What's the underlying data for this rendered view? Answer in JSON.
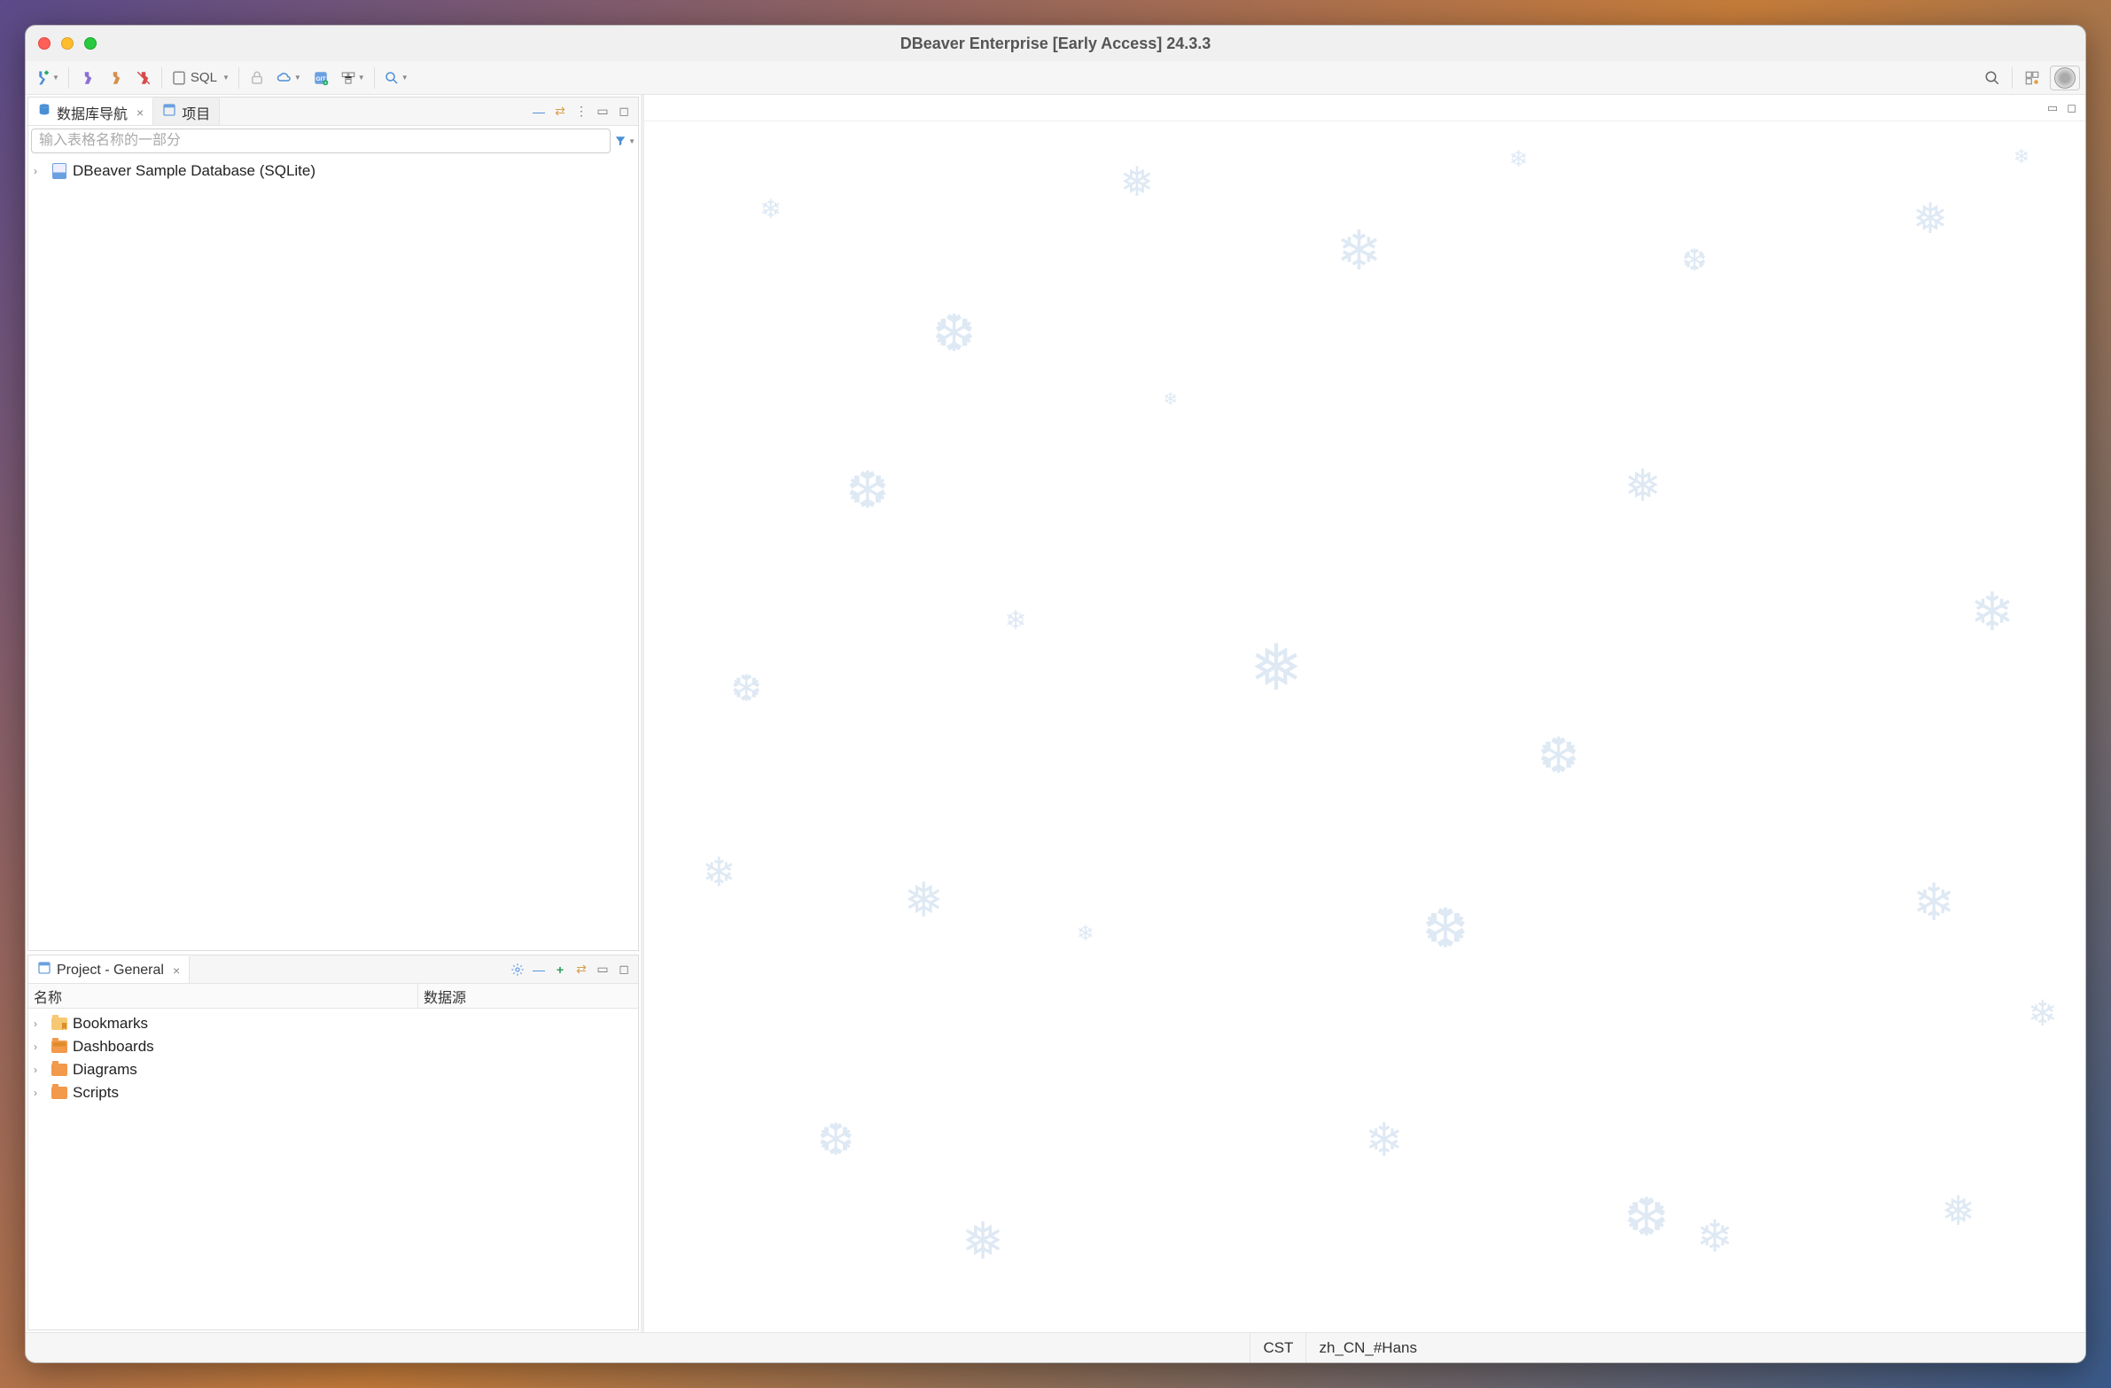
{
  "window": {
    "title": "DBeaver Enterprise [Early Access] 24.3.3"
  },
  "toolbar": {
    "sql_label": "SQL"
  },
  "navigator": {
    "tab_label": "数据库导航",
    "projects_tab_label": "项目",
    "filter_placeholder": "输入表格名称的一部分",
    "items": [
      {
        "label": "DBeaver Sample Database (SQLite)"
      }
    ]
  },
  "project_panel": {
    "tab_label": "Project - General",
    "columns": {
      "name": "名称",
      "datasource": "数据源"
    },
    "items": [
      {
        "label": "Bookmarks"
      },
      {
        "label": "Dashboards"
      },
      {
        "label": "Diagrams"
      },
      {
        "label": "Scripts"
      }
    ]
  },
  "statusbar": {
    "timezone": "CST",
    "locale": "zh_CN_#Hans"
  }
}
